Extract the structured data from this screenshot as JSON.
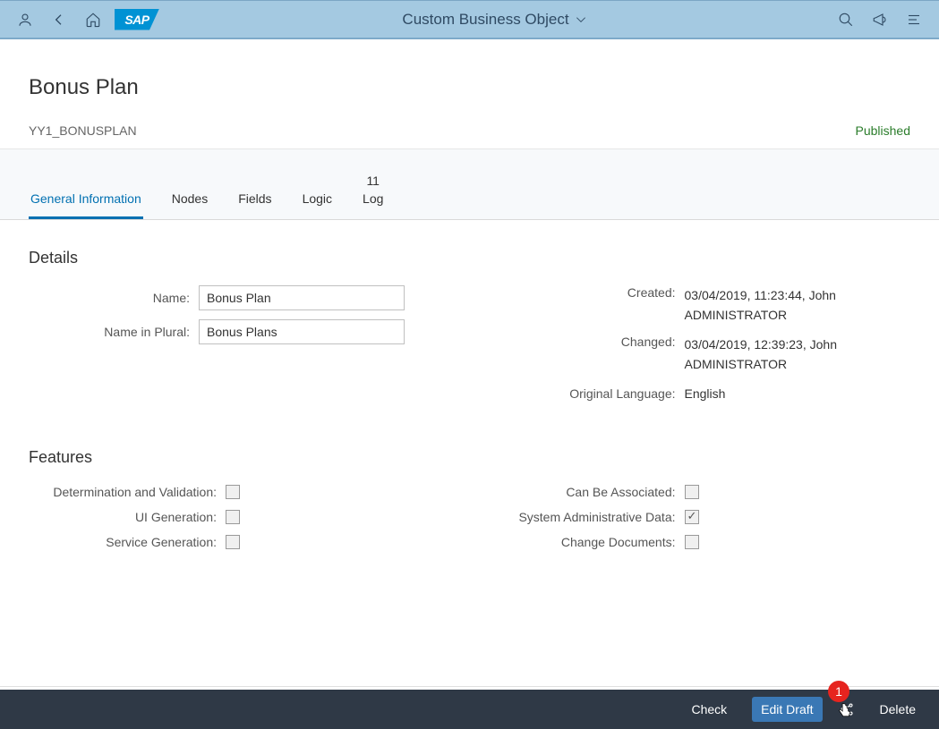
{
  "header": {
    "title": "Custom Business Object"
  },
  "page": {
    "title": "Bonus Plan",
    "technical_id": "YY1_BONUSPLAN",
    "status": "Published"
  },
  "tabs": {
    "general": "General Information",
    "nodes": "Nodes",
    "fields": "Fields",
    "logic": "Logic",
    "log_count": "11",
    "log": "Log"
  },
  "details": {
    "section_title": "Details",
    "name_label": "Name:",
    "name_value": "Bonus Plan",
    "plural_label": "Name in Plural:",
    "plural_value": "Bonus Plans",
    "created_label": "Created:",
    "created_value": "03/04/2019, 11:23:44, John ADMINISTRATOR",
    "changed_label": "Changed:",
    "changed_value": "03/04/2019, 12:39:23, John ADMINISTRATOR",
    "orig_lang_label": "Original Language:",
    "orig_lang_value": "English"
  },
  "features": {
    "section_title": "Features",
    "det_val": "Determination and Validation:",
    "ui_gen": "UI Generation:",
    "svc_gen": "Service Generation:",
    "can_assoc": "Can Be Associated:",
    "sys_admin": "System Administrative Data:",
    "chg_docs": "Change Documents:",
    "sys_admin_checked": true
  },
  "footer": {
    "check": "Check",
    "edit_draft": "Edit Draft",
    "delete": "Delete",
    "badge": "1"
  }
}
